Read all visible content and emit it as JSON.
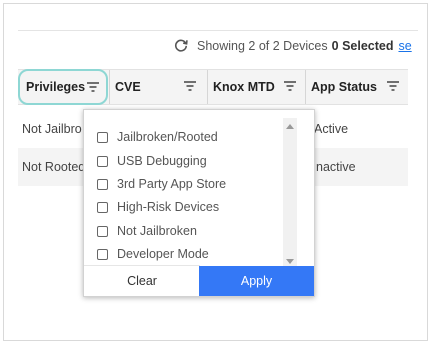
{
  "status": {
    "count_text": "Showing 2 of 2 Devices",
    "selected_text": "0 Selected",
    "link_text": "se"
  },
  "columns": [
    {
      "label": "Privileges"
    },
    {
      "label": "CVE"
    },
    {
      "label": "Knox MTD"
    },
    {
      "label": "App Status"
    }
  ],
  "rows": [
    {
      "privileges": "Not Jailbro",
      "app_status": "Active"
    },
    {
      "privileges": "Not Rooted",
      "app_status": "nactive"
    }
  ],
  "filter_menu": {
    "options": [
      {
        "label": "Jailbroken/Rooted",
        "checked": false
      },
      {
        "label": "USB Debugging",
        "checked": false
      },
      {
        "label": "3rd Party App Store",
        "checked": false
      },
      {
        "label": "High-Risk Devices",
        "checked": false
      },
      {
        "label": "Not Jailbroken",
        "checked": false
      },
      {
        "label": "Developer Mode",
        "checked": false
      }
    ],
    "clear_label": "Clear",
    "apply_label": "Apply"
  },
  "colors": {
    "apply_button": "#3478f6",
    "focus_ring": "#8ed7d4",
    "link": "#1a73e8"
  }
}
